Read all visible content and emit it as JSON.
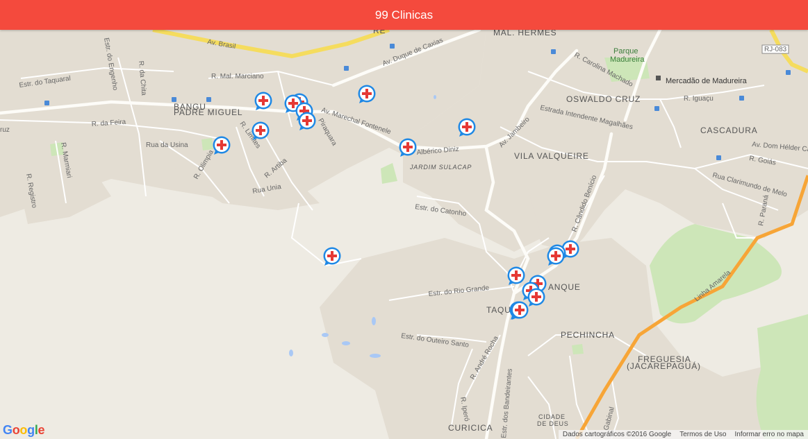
{
  "header": {
    "title": "99 Clinicas"
  },
  "map": {
    "districts": [
      "BANGU",
      "PADRE MIGUEL",
      "MAL. HERMES",
      "OSWALDO CRUZ",
      "CASCADURA",
      "VILA VALQUEIRE",
      "TAQU",
      "ANQUE",
      "PECHINCHA",
      "FREGUESIA",
      "(JACAREPAGUÁ)",
      "CIDADE",
      "DE DEUS",
      "CURICICA",
      "JARDIM SULACAP",
      "RE"
    ],
    "streets": [
      "Av. Brasil",
      "Av. Duque de Caxias",
      "R. Mal. Marciano",
      "Estr. do Taquaral",
      "Estr. do Engenho",
      "R. da Chita",
      "Av. Marechal Fontenele",
      "Piraquara",
      "R. da Feira",
      "Rua da Usina",
      "R. Marmiari",
      "R. Olimpia",
      "R. Limites",
      "R. Artiba",
      "Rua Unia",
      "R. Registro",
      "Albérico Diniz",
      "Estr. do Catonho",
      "Estrada Intendente Magalhães",
      "Av. Jambeiro",
      "R. Carolina Machado",
      "R. Iguaçu",
      "Av. Dom Hélder Câ",
      "R. Goiás",
      "Rua Clarimundo de Melo",
      "R. Paraná",
      "R. Cândido Benício",
      "Linha Amarela",
      "Estr. do Rio Grande",
      "Estr. do Outeiro Santo",
      "R. André Rocha",
      "R. Iperó",
      "Estr. dos Bandeirantes",
      "Gabinal",
      "ruz"
    ],
    "pois": [
      "Mercadão de Madureira",
      "Parque",
      "Madureira",
      "RJ-083"
    ],
    "google_logo": [
      "G",
      "o",
      "o",
      "g",
      "l",
      "e"
    ],
    "attribution": [
      "Dados cartográficos ©2016 Google",
      "Termos de Uso",
      "Informar erro no mapa"
    ]
  },
  "markers": [
    {
      "name": "clinic-marker-1"
    },
    {
      "name": "clinic-marker-2"
    },
    {
      "name": "clinic-marker-3"
    },
    {
      "name": "clinic-marker-4"
    },
    {
      "name": "clinic-marker-5"
    },
    {
      "name": "clinic-marker-6"
    },
    {
      "name": "clinic-marker-7"
    },
    {
      "name": "clinic-marker-8"
    },
    {
      "name": "clinic-marker-9"
    },
    {
      "name": "clinic-marker-10"
    },
    {
      "name": "clinic-marker-11"
    },
    {
      "name": "clinic-marker-12"
    },
    {
      "name": "clinic-marker-13"
    },
    {
      "name": "clinic-marker-14"
    },
    {
      "name": "clinic-marker-15"
    },
    {
      "name": "clinic-marker-16"
    },
    {
      "name": "clinic-marker-17"
    },
    {
      "name": "clinic-marker-18"
    },
    {
      "name": "clinic-marker-19"
    },
    {
      "name": "clinic-marker-20"
    }
  ],
  "colors": {
    "header": "#f44a3d",
    "marker_ring": "#1e88e5",
    "marker_cross": "#e53935",
    "highway": "#f7a537",
    "park": "#cde6b8"
  }
}
